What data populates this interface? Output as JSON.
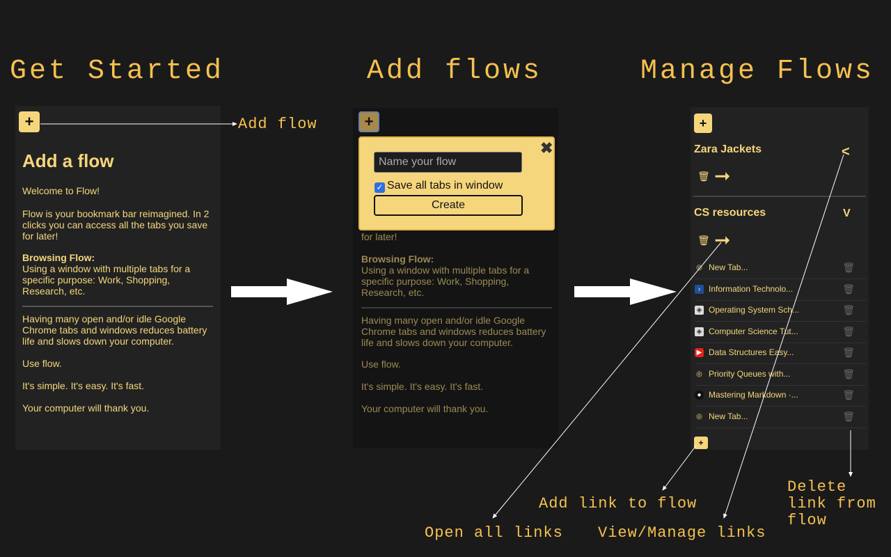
{
  "headings": {
    "get_started": "Get Started",
    "add_flows": "Add flows",
    "manage_flows": "Manage Flows"
  },
  "annotations": {
    "add_flow": "Add flow",
    "add_link": "Add link to flow",
    "open_all": "Open all links",
    "view_manage": "View/Manage links",
    "delete_link_1": "Delete",
    "delete_link_2": "link from",
    "delete_link_3": "flow"
  },
  "panel1": {
    "add_label": "+",
    "title": "Add a flow",
    "welcome": "Welcome to Flow!",
    "intro": "Flow is your bookmark bar reimagined. In 2 clicks you can access all the tabs you save for later!",
    "browsing_label": "Browsing Flow:",
    "browsing_desc": "Using a window with multiple tabs for a specific purpose: Work, Shopping, Research, etc.",
    "idle": "Having many open and/or idle Google Chrome tabs and windows reduces battery life and slows down your computer.",
    "use": "Use flow.",
    "simple": "It's simple. It's easy. It's fast.",
    "thanks": "Your computer will thank you."
  },
  "panel2": {
    "add_label": "+",
    "modal": {
      "placeholder": "Name your flow",
      "checkbox_label": "Save all tabs in window",
      "checkbox_mark": "✓",
      "create_label": "Create",
      "close_label": "✖"
    },
    "later": "for later!",
    "browsing_label": "Browsing Flow:",
    "browsing_desc": "Using a window with multiple tabs for a specific purpose: Work, Shopping, Research, etc.",
    "idle": "Having many open and/or idle Google Chrome tabs and windows reduces battery life and slows down your computer.",
    "use": "Use flow.",
    "simple": "It's simple. It's easy. It's fast.",
    "thanks": "Your computer will thank you."
  },
  "panel3": {
    "add_label": "+",
    "flows": [
      {
        "title": "Zara Jackets",
        "chevron": "<"
      },
      {
        "title": "CS resources",
        "chevron": "V"
      }
    ],
    "links": [
      {
        "label": "New Tab...",
        "icon": "globe-icon"
      },
      {
        "label": "Information Technolo...",
        "icon": "site-icon"
      },
      {
        "label": "Operating System Sch...",
        "icon": "site-icon"
      },
      {
        "label": "Computer Science Tut...",
        "icon": "site-icon"
      },
      {
        "label": "Data Structures Easy...",
        "icon": "youtube-icon"
      },
      {
        "label": "Priority Queues with...",
        "icon": "globe-icon"
      },
      {
        "label": "Mastering Markdown ·...",
        "icon": "github-icon"
      },
      {
        "label": "New Tab...",
        "icon": "globe-icon"
      }
    ],
    "add_link_label": "+"
  },
  "colors": {
    "accent": "#f6d67c",
    "heading": "#f5c150",
    "background": "#1a1a1a"
  }
}
